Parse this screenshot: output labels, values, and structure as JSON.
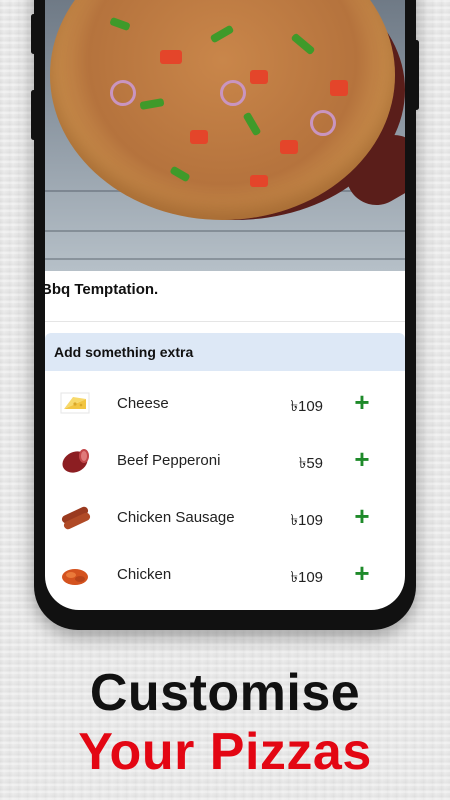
{
  "product": {
    "title": "Bbq Temptation."
  },
  "extras": {
    "header": "Add something extra",
    "items": [
      {
        "name": "Cheese",
        "price": "৳109",
        "icon": "cheese-icon",
        "add": "+"
      },
      {
        "name": "Beef Pepperoni",
        "price": "৳59",
        "icon": "pepperoni-icon",
        "add": "+"
      },
      {
        "name": "Chicken Sausage",
        "price": "৳109",
        "icon": "sausage-icon",
        "add": "+"
      },
      {
        "name": "Chicken",
        "price": "৳109",
        "icon": "chicken-icon",
        "add": "+"
      }
    ]
  },
  "promo": {
    "line1": "Customise",
    "line2": "Your Pizzas"
  },
  "colors": {
    "accent_red": "#e30613",
    "add_green": "#1e8a2a",
    "header_bg": "#dde8f6"
  }
}
